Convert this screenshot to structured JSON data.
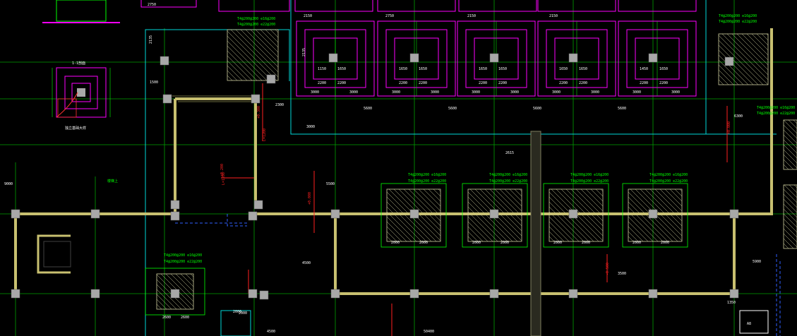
{
  "colors": {
    "background": "#000000",
    "grid_line": "#00b000",
    "wall": "#c8c070",
    "column": "#a8a8a8",
    "cap": "#ff00ff",
    "footing_outline": "#00ff00",
    "hatch": "#d0d0a0",
    "cyan": "#00e0e0",
    "red": "#ff2020",
    "blue": "#3060ff",
    "white": "#ffffff"
  },
  "labels": {
    "cap_dims": [
      "2150",
      "2750",
      "2150",
      "2150"
    ],
    "top_dim_1": "2750",
    "cap_side_1": "2135",
    "cap_side_2": "2135",
    "cap_inner": [
      "1150",
      "1650",
      "1650",
      "1650",
      "1650",
      "1650",
      "1650",
      "1650",
      "1450",
      "1650"
    ],
    "cap_mid": [
      "2200",
      "2200",
      "2200",
      "2200",
      "2200",
      "2200",
      "2200",
      "2200",
      "2200",
      "2200"
    ],
    "cap_outer": [
      "3000",
      "3000",
      "3000",
      "3000",
      "3000",
      "3000",
      "3000",
      "3000",
      "3000",
      "3000"
    ],
    "cap_notes": [
      "5600",
      "5600",
      "5600",
      "5600"
    ],
    "footing_left_dims": [
      "2400",
      "3000"
    ],
    "footing_dims": [
      "2000",
      "2000",
      "2000",
      "2000",
      "2000",
      "2000",
      "2000",
      "2000"
    ],
    "footing_side_dims": [
      "875",
      "875",
      "875",
      "875",
      "875",
      "875",
      "875",
      "875"
    ],
    "left_footing_dims": [
      "2600",
      "2600"
    ],
    "grid_dims": [
      "1500",
      "2300",
      "3000",
      "2615",
      "9000",
      "2000",
      "4500",
      "5900",
      "6300",
      "5500"
    ],
    "bottom_dims": [
      "2000",
      "4500",
      "2115",
      "50400",
      "3500",
      "1350"
    ],
    "notes_green": [
      "T4@200@200 e16@200",
      "T4@200@200 e22@200"
    ],
    "red_marks": [
      "+0.200",
      "L=1200",
      "+0.300",
      "L=1200",
      "+0.000",
      "-0.500",
      "+0.000"
    ],
    "stair_label": "楼梯上",
    "detail_title": "1-1剖面",
    "detail_caption": "独立基础大样",
    "legend": "地梁信息",
    "cad_icon_text": "A8"
  }
}
